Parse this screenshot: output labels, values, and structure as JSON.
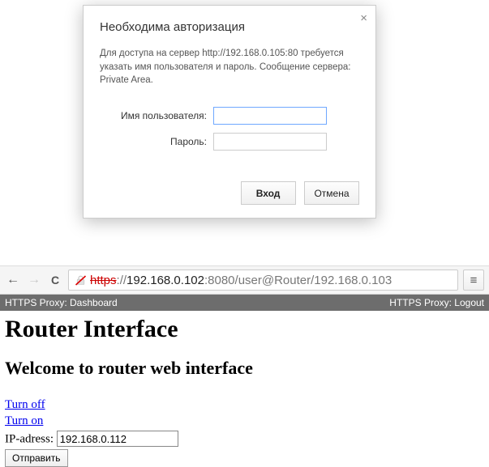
{
  "dialog": {
    "title": "Необходима авторизация",
    "message": "Для доступа на сервер http://192.168.0.105:80 требуется указать имя пользователя и пароль. Сообщение сервера: Private Area.",
    "username_label": "Имя пользователя:",
    "password_label": "Пароль:",
    "username_value": "",
    "password_value": "",
    "login_label": "Вход",
    "cancel_label": "Отмена",
    "close_glyph": "×"
  },
  "browser": {
    "back_glyph": "←",
    "forward_glyph": "→",
    "reload_glyph": "C",
    "menu_glyph": "≡",
    "url_scheme": "https",
    "url_sep": "://",
    "url_host": "192.168.0.102",
    "url_rest": ":8080/user@Router/192.168.0.103"
  },
  "proxy_bar": {
    "left": "HTTPS Proxy: Dashboard",
    "right": "HTTPS Proxy: Logout"
  },
  "page": {
    "h1": "Router Interface",
    "h2": "Welcome to router web interface",
    "link_off": "Turn off",
    "link_on": "Turn on",
    "ip_label": "IP-adress: ",
    "ip_value": "192.168.0.112",
    "submit_label": "Отправить"
  }
}
